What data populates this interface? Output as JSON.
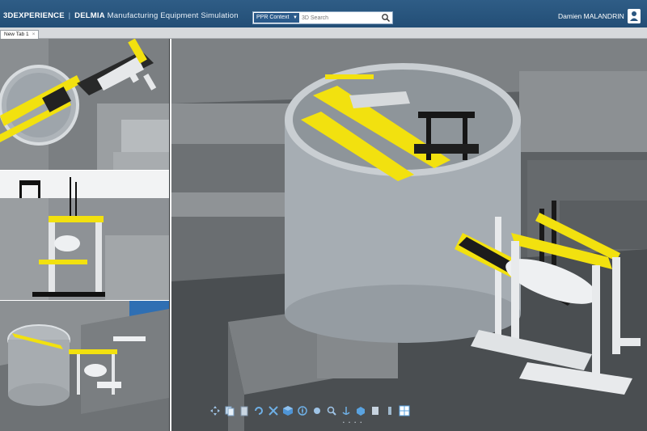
{
  "app": {
    "brand_logo": "3DEXPERIENCE",
    "brand_separator": "|",
    "brand_app": "DELMIA",
    "brand_subtitle": "Manufacturing Equipment Simulation"
  },
  "search": {
    "context_label": "PPR Context",
    "placeholder": "3D Search"
  },
  "user": {
    "name": "Damien MALANDRIN"
  },
  "tabs": [
    {
      "label": "New Tab 1"
    }
  ],
  "toolbar": {
    "icons": [
      "pan-icon",
      "copy-icon",
      "paste-icon",
      "rotate-icon",
      "fit-all-icon",
      "cube-icon",
      "compass-icon",
      "view-icon",
      "zoom-icon",
      "anchor-icon",
      "measure-icon",
      "render-icon",
      "pin-icon",
      "layout-icon"
    ]
  },
  "colors": {
    "titlebar": "#2a5680",
    "accent_yellow": "#f2e10f",
    "steel_white": "#e8eaec",
    "concrete": "#a9b0b6"
  }
}
